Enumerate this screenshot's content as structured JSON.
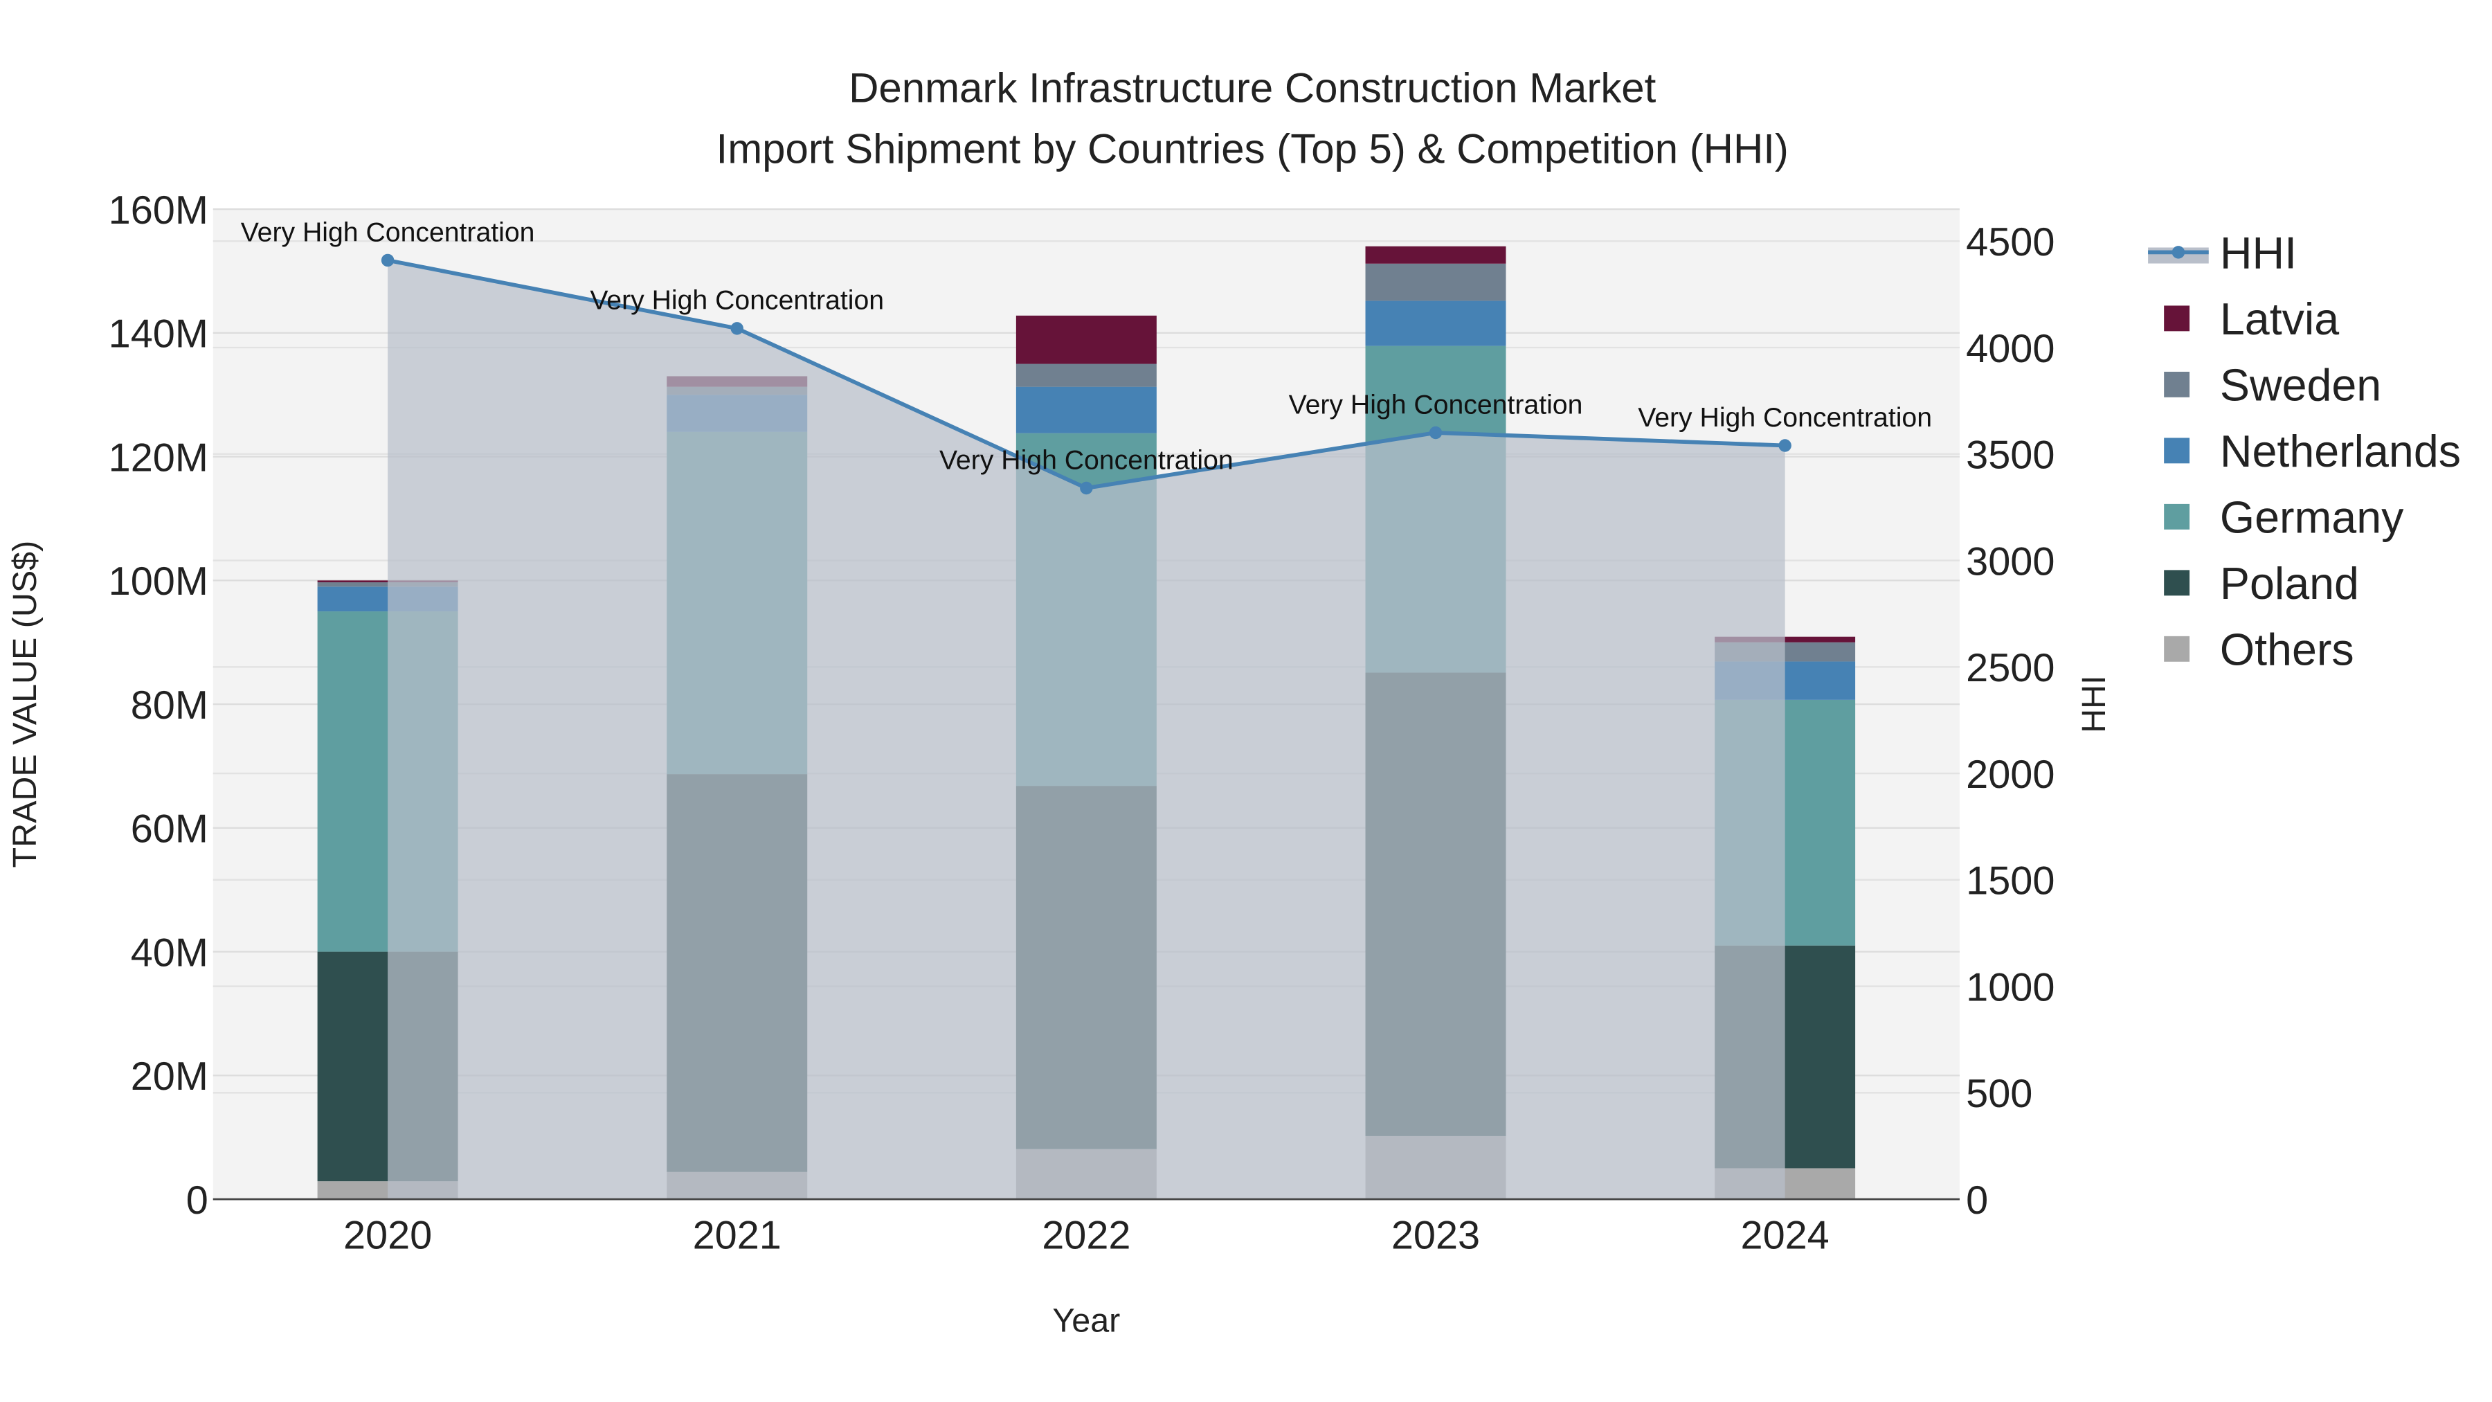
{
  "chart_data": {
    "type": "bar",
    "title_line1": "Denmark Infrastructure Construction Market",
    "title_line2": "Import Shipment by Countries (Top 5) & Competition (HHI)",
    "xlabel": "Year",
    "ylabel": "TRADE VALUE (US$)",
    "y2label": "HHI",
    "categories": [
      "2020",
      "2021",
      "2022",
      "2023",
      "2024"
    ],
    "ylim": [
      0,
      160
    ],
    "y_ticks": [
      "0",
      "20M",
      "40M",
      "60M",
      "80M",
      "100M",
      "120M",
      "140M",
      "160M"
    ],
    "y2lim": [
      0,
      4650
    ],
    "y2_ticks": [
      "0",
      "500",
      "1000",
      "1500",
      "2000",
      "2500",
      "3000",
      "3500",
      "4000",
      "4500"
    ],
    "units": "US$ millions",
    "stack_order": "bottom-to-top",
    "series": [
      {
        "name": "Others",
        "color": "#a9a9a9",
        "values": [
          2.9,
          4.4,
          8.1,
          10.2,
          5.0
        ]
      },
      {
        "name": "Poland",
        "color": "#2f4f4f",
        "values": [
          37.1,
          64.3,
          58.7,
          74.9,
          36.0
        ]
      },
      {
        "name": "Germany",
        "color": "#5f9ea0",
        "values": [
          55.0,
          55.3,
          57.0,
          52.8,
          39.7
        ]
      },
      {
        "name": "Netherlands",
        "color": "#4682b4",
        "values": [
          4.0,
          6.0,
          7.5,
          7.3,
          6.2
        ]
      },
      {
        "name": "Sweden",
        "color": "#708090",
        "values": [
          0.7,
          1.3,
          3.7,
          6.0,
          3.1
        ]
      },
      {
        "name": "Latvia",
        "color": "#661339",
        "values": [
          0.3,
          1.7,
          7.8,
          2.8,
          0.9
        ]
      }
    ],
    "hhi": {
      "name": "HHI",
      "color": "#4682b4",
      "values": [
        4410,
        4090,
        3340,
        3600,
        3540
      ],
      "annotations": [
        "Very High Concentration",
        "Very High Concentration",
        "Very High Concentration",
        "Very High Concentration",
        "Very High Concentration"
      ]
    },
    "legend": [
      "HHI",
      "Latvia",
      "Sweden",
      "Netherlands",
      "Germany",
      "Poland",
      "Others"
    ],
    "legend_placement": "right",
    "grid": true
  }
}
